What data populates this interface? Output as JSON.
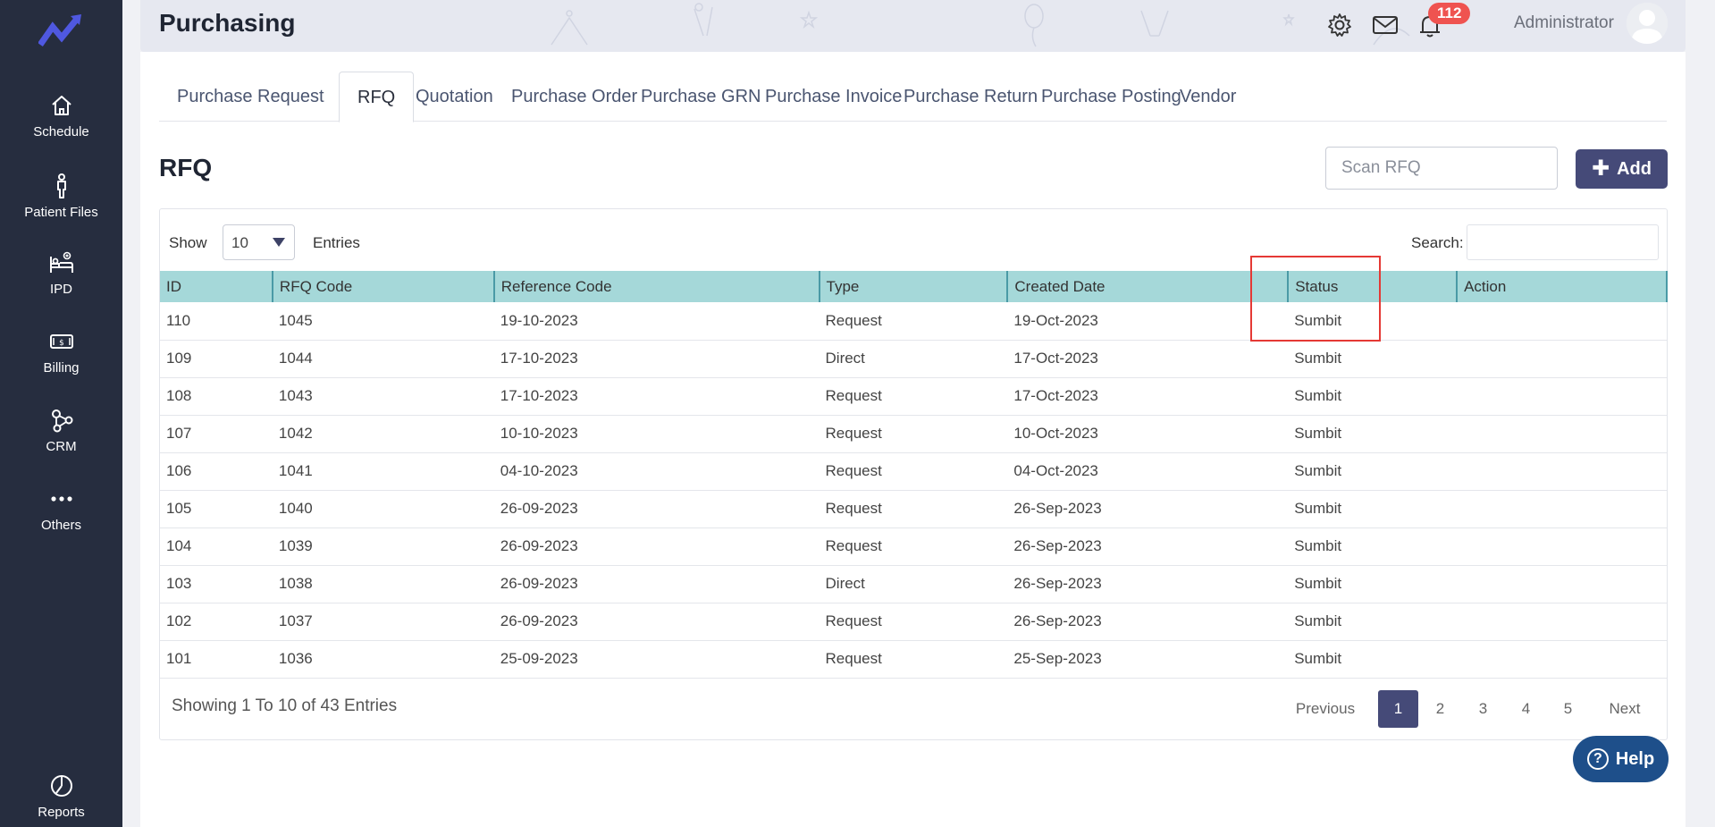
{
  "sidebar": {
    "items": [
      {
        "label": "Schedule",
        "icon": "home-icon"
      },
      {
        "label": "Patient Files",
        "icon": "person-icon"
      },
      {
        "label": "IPD",
        "icon": "bed-icon"
      },
      {
        "label": "Billing",
        "icon": "cash-icon"
      },
      {
        "label": "CRM",
        "icon": "network-icon"
      },
      {
        "label": "Others",
        "icon": "more-icon"
      },
      {
        "label": "Reports",
        "icon": "pie-chart-icon"
      }
    ]
  },
  "header": {
    "title": "Purchasing",
    "notification_count": "112",
    "user_name": "Administrator"
  },
  "tabs": [
    "Purchase Request",
    "RFQ",
    "Quotation",
    "Purchase Order",
    "Purchase GRN",
    "Purchase Invoice",
    "Purchase Return",
    "Purchase Posting",
    "Vendor"
  ],
  "active_tab": "RFQ",
  "section": {
    "title": "RFQ",
    "scan_placeholder": "Scan RFQ",
    "add_label": "Add"
  },
  "table_controls": {
    "show_label": "Show",
    "entries_value": "10",
    "entries_label": "Entries",
    "search_label": "Search:"
  },
  "table": {
    "columns": [
      "ID",
      "RFQ Code",
      "Reference Code",
      "Type",
      "Created Date",
      "Status",
      "Action"
    ],
    "rows": [
      [
        "110",
        "1045",
        "19-10-2023",
        "Request",
        "19-Oct-2023",
        "Sumbit",
        ""
      ],
      [
        "109",
        "1044",
        "17-10-2023",
        "Direct",
        "17-Oct-2023",
        "Sumbit",
        ""
      ],
      [
        "108",
        "1043",
        "17-10-2023",
        "Request",
        "17-Oct-2023",
        "Sumbit",
        ""
      ],
      [
        "107",
        "1042",
        "10-10-2023",
        "Request",
        "10-Oct-2023",
        "Sumbit",
        ""
      ],
      [
        "106",
        "1041",
        "04-10-2023",
        "Request",
        "04-Oct-2023",
        "Sumbit",
        ""
      ],
      [
        "105",
        "1040",
        "26-09-2023",
        "Request",
        "26-Sep-2023",
        "Sumbit",
        ""
      ],
      [
        "104",
        "1039",
        "26-09-2023",
        "Request",
        "26-Sep-2023",
        "Sumbit",
        ""
      ],
      [
        "103",
        "1038",
        "26-09-2023",
        "Direct",
        "26-Sep-2023",
        "Sumbit",
        ""
      ],
      [
        "102",
        "1037",
        "26-09-2023",
        "Request",
        "26-Sep-2023",
        "Sumbit",
        ""
      ],
      [
        "101",
        "1036",
        "25-09-2023",
        "Request",
        "25-Sep-2023",
        "Sumbit",
        ""
      ]
    ]
  },
  "pagination": {
    "summary": "Showing 1 To 10 of 43 Entries",
    "previous": "Previous",
    "pages": [
      "1",
      "2",
      "3",
      "4",
      "5"
    ],
    "current_page": "1",
    "next": "Next"
  },
  "help": {
    "label": "Help"
  },
  "colors": {
    "sidebar_bg": "#262d3f",
    "accent": "#454a78",
    "table_header": "#a5d8d9",
    "badge": "#ef5350",
    "highlight": "#e53935",
    "help_bg": "#1e4f8a"
  }
}
